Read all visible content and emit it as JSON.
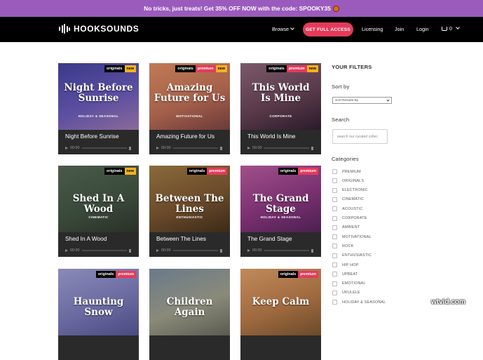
{
  "promo": {
    "text": "No tricks, just treats! Get 35% OFF NOW with the code: SPOOKY35",
    "emoji": "jack-o-lantern-icon"
  },
  "nav": {
    "logo": "HOOKSOUNDS",
    "browse": "Browse",
    "cta": "GET FULL ACCESS",
    "licensing": "Licensing",
    "join": "Join",
    "login": "Login",
    "cart_count": "0"
  },
  "tracks": [
    {
      "name": "Night Before Sunrise",
      "art_line1": "Night Before",
      "art_line2": "Sunrise",
      "genre": "HOLIDAY & SEASONAL",
      "tags": [
        "originals",
        "new"
      ],
      "time": "00:00",
      "colors": [
        "#3b3a8a",
        "#5b4ea0",
        "#8a6a9a"
      ]
    },
    {
      "name": "Amazing Future for Us",
      "art_line1": "Amazing",
      "art_line2": "Future for Us",
      "genre": "MOTIVATIONAL",
      "tags": [
        "originals",
        "premium",
        "new"
      ],
      "time": "00:00",
      "colors": [
        "#c07a55",
        "#a5604a",
        "#6a3a3a"
      ]
    },
    {
      "name": "This World Is Mine",
      "art_line1": "This World",
      "art_line2": "Is Mine",
      "genre": "CORPORATE",
      "tags": [
        "originals",
        "premium",
        "new"
      ],
      "time": "00:00",
      "colors": [
        "#7a5a6a",
        "#5a3a4a",
        "#2a1a2a"
      ]
    },
    {
      "name": "Shed In A Wood",
      "art_line1": "Shed In A Wood",
      "art_line2": "",
      "genre": "CINEMATIC",
      "tags": [
        "originals",
        "new"
      ],
      "time": "00:00",
      "colors": [
        "#4a5a4a",
        "#3a4a3a",
        "#2a3028"
      ]
    },
    {
      "name": "Between The Lines",
      "art_line1": "Between The Lines",
      "art_line2": "",
      "genre": "ENTHUSIASTIC",
      "tags": [
        "originals",
        "premium"
      ],
      "time": "00:00",
      "colors": [
        "#8a6a3a",
        "#6a4a2a",
        "#3a2a18"
      ]
    },
    {
      "name": "The Grand Stage",
      "art_line1": "The Grand Stage",
      "art_line2": "",
      "genre": "HOLIDAY & SEASONAL",
      "tags": [
        "originals",
        "premium"
      ],
      "time": "00:00",
      "colors": [
        "#a0508a",
        "#7a3070",
        "#4a2050"
      ]
    },
    {
      "name": "",
      "art_line1": "Haunting Snow",
      "art_line2": "",
      "genre": "",
      "tags": [
        "originals",
        "premium"
      ],
      "time": "",
      "colors": [
        "#8a8ab8",
        "#6a6aa0",
        "#4a4a80"
      ]
    },
    {
      "name": "",
      "art_line1": "Children Again",
      "art_line2": "",
      "genre": "",
      "tags": [],
      "time": "",
      "colors": [
        "#6a7a8a",
        "#8a8a7a",
        "#5a5a50"
      ]
    },
    {
      "name": "",
      "art_line1": "Keep Calm",
      "art_line2": "",
      "genre": "",
      "tags": [
        "originals",
        "premium"
      ],
      "time": "",
      "colors": [
        "#c08a5a",
        "#a06a40",
        "#6a4a2a"
      ]
    }
  ],
  "filters": {
    "heading": "YOUR FILTERS",
    "sort_label": "Sort by",
    "sort_value": "Sort Results By",
    "search_label": "Search",
    "search_placeholder": "search our curated collec",
    "categories_label": "Categories",
    "categories": [
      "PREMIUM",
      "ORIGINALS",
      "ELECTRONIC",
      "CINEMATIC",
      "ACOUSTIC",
      "CORPORATE",
      "AMBIENT",
      "MOTIVATIONAL",
      "ROCK",
      "ENTHUSIASTIC",
      "HIP HOP",
      "UPBEAT",
      "EMOTIONAL",
      "UKULELE",
      "HOLIDAY & SEASONAL"
    ]
  },
  "watermark": "wtvid.com"
}
